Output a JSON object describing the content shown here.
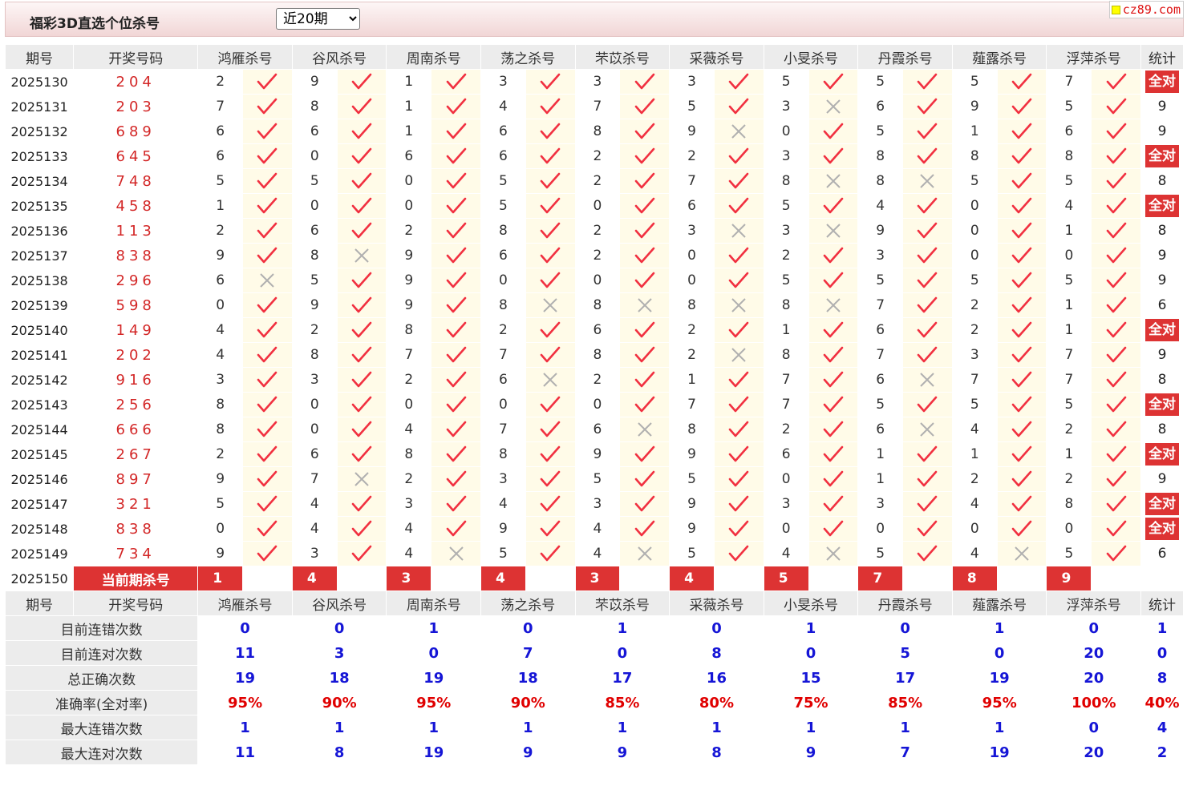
{
  "header": {
    "title": "福彩3D直选个位杀号",
    "period_select": {
      "selected": "近20期"
    }
  },
  "logo": {
    "text": "cz89.com"
  },
  "colors": {
    "check": "#f13040",
    "cross": "#b0b0b0",
    "accent_red": "#dd3333",
    "stat_blue": "#1515d6"
  },
  "table": {
    "headers": [
      "期号",
      "开奖号码",
      "鸿雁杀号",
      "谷风杀号",
      "周南杀号",
      "荡之杀号",
      "芣苡杀号",
      "采薇杀号",
      "小旻杀号",
      "丹霞杀号",
      "薤露杀号",
      "浮萍杀号",
      "统计"
    ],
    "rows": [
      {
        "issue": "2025130",
        "draw": "204",
        "kills": [
          [
            "2",
            true
          ],
          [
            "9",
            true
          ],
          [
            "1",
            true
          ],
          [
            "3",
            true
          ],
          [
            "3",
            true
          ],
          [
            "3",
            true
          ],
          [
            "5",
            true
          ],
          [
            "5",
            true
          ],
          [
            "5",
            true
          ],
          [
            "7",
            true
          ]
        ],
        "stat": "全对"
      },
      {
        "issue": "2025131",
        "draw": "203",
        "kills": [
          [
            "7",
            true
          ],
          [
            "8",
            true
          ],
          [
            "1",
            true
          ],
          [
            "4",
            true
          ],
          [
            "7",
            true
          ],
          [
            "5",
            true
          ],
          [
            "3",
            false
          ],
          [
            "6",
            true
          ],
          [
            "9",
            true
          ],
          [
            "5",
            true
          ]
        ],
        "stat": "9"
      },
      {
        "issue": "2025132",
        "draw": "689",
        "kills": [
          [
            "6",
            true
          ],
          [
            "6",
            true
          ],
          [
            "1",
            true
          ],
          [
            "6",
            true
          ],
          [
            "8",
            true
          ],
          [
            "9",
            false
          ],
          [
            "0",
            true
          ],
          [
            "5",
            true
          ],
          [
            "1",
            true
          ],
          [
            "6",
            true
          ]
        ],
        "stat": "9"
      },
      {
        "issue": "2025133",
        "draw": "645",
        "kills": [
          [
            "6",
            true
          ],
          [
            "0",
            true
          ],
          [
            "6",
            true
          ],
          [
            "6",
            true
          ],
          [
            "2",
            true
          ],
          [
            "2",
            true
          ],
          [
            "3",
            true
          ],
          [
            "8",
            true
          ],
          [
            "8",
            true
          ],
          [
            "8",
            true
          ]
        ],
        "stat": "全对"
      },
      {
        "issue": "2025134",
        "draw": "748",
        "kills": [
          [
            "5",
            true
          ],
          [
            "5",
            true
          ],
          [
            "0",
            true
          ],
          [
            "5",
            true
          ],
          [
            "2",
            true
          ],
          [
            "7",
            true
          ],
          [
            "8",
            false
          ],
          [
            "8",
            false
          ],
          [
            "5",
            true
          ],
          [
            "5",
            true
          ]
        ],
        "stat": "8"
      },
      {
        "issue": "2025135",
        "draw": "458",
        "kills": [
          [
            "1",
            true
          ],
          [
            "0",
            true
          ],
          [
            "0",
            true
          ],
          [
            "5",
            true
          ],
          [
            "0",
            true
          ],
          [
            "6",
            true
          ],
          [
            "5",
            true
          ],
          [
            "4",
            true
          ],
          [
            "0",
            true
          ],
          [
            "4",
            true
          ]
        ],
        "stat": "全对"
      },
      {
        "issue": "2025136",
        "draw": "113",
        "kills": [
          [
            "2",
            true
          ],
          [
            "6",
            true
          ],
          [
            "2",
            true
          ],
          [
            "8",
            true
          ],
          [
            "2",
            true
          ],
          [
            "3",
            false
          ],
          [
            "3",
            false
          ],
          [
            "9",
            true
          ],
          [
            "0",
            true
          ],
          [
            "1",
            true
          ]
        ],
        "stat": "8"
      },
      {
        "issue": "2025137",
        "draw": "838",
        "kills": [
          [
            "9",
            true
          ],
          [
            "8",
            false
          ],
          [
            "9",
            true
          ],
          [
            "6",
            true
          ],
          [
            "2",
            true
          ],
          [
            "0",
            true
          ],
          [
            "2",
            true
          ],
          [
            "3",
            true
          ],
          [
            "0",
            true
          ],
          [
            "0",
            true
          ]
        ],
        "stat": "9"
      },
      {
        "issue": "2025138",
        "draw": "296",
        "kills": [
          [
            "6",
            false
          ],
          [
            "5",
            true
          ],
          [
            "9",
            true
          ],
          [
            "0",
            true
          ],
          [
            "0",
            true
          ],
          [
            "0",
            true
          ],
          [
            "5",
            true
          ],
          [
            "5",
            true
          ],
          [
            "5",
            true
          ],
          [
            "5",
            true
          ]
        ],
        "stat": "9"
      },
      {
        "issue": "2025139",
        "draw": "598",
        "kills": [
          [
            "0",
            true
          ],
          [
            "9",
            true
          ],
          [
            "9",
            true
          ],
          [
            "8",
            false
          ],
          [
            "8",
            false
          ],
          [
            "8",
            false
          ],
          [
            "8",
            false
          ],
          [
            "7",
            true
          ],
          [
            "2",
            true
          ],
          [
            "1",
            true
          ]
        ],
        "stat": "6"
      },
      {
        "issue": "2025140",
        "draw": "149",
        "kills": [
          [
            "4",
            true
          ],
          [
            "2",
            true
          ],
          [
            "8",
            true
          ],
          [
            "2",
            true
          ],
          [
            "6",
            true
          ],
          [
            "2",
            true
          ],
          [
            "1",
            true
          ],
          [
            "6",
            true
          ],
          [
            "2",
            true
          ],
          [
            "1",
            true
          ]
        ],
        "stat": "全对"
      },
      {
        "issue": "2025141",
        "draw": "202",
        "kills": [
          [
            "4",
            true
          ],
          [
            "8",
            true
          ],
          [
            "7",
            true
          ],
          [
            "7",
            true
          ],
          [
            "8",
            true
          ],
          [
            "2",
            false
          ],
          [
            "8",
            true
          ],
          [
            "7",
            true
          ],
          [
            "3",
            true
          ],
          [
            "7",
            true
          ]
        ],
        "stat": "9"
      },
      {
        "issue": "2025142",
        "draw": "916",
        "kills": [
          [
            "3",
            true
          ],
          [
            "3",
            true
          ],
          [
            "2",
            true
          ],
          [
            "6",
            false
          ],
          [
            "2",
            true
          ],
          [
            "1",
            true
          ],
          [
            "7",
            true
          ],
          [
            "6",
            false
          ],
          [
            "7",
            true
          ],
          [
            "7",
            true
          ]
        ],
        "stat": "8"
      },
      {
        "issue": "2025143",
        "draw": "256",
        "kills": [
          [
            "8",
            true
          ],
          [
            "0",
            true
          ],
          [
            "0",
            true
          ],
          [
            "0",
            true
          ],
          [
            "0",
            true
          ],
          [
            "7",
            true
          ],
          [
            "7",
            true
          ],
          [
            "5",
            true
          ],
          [
            "5",
            true
          ],
          [
            "5",
            true
          ]
        ],
        "stat": "全对"
      },
      {
        "issue": "2025144",
        "draw": "666",
        "kills": [
          [
            "8",
            true
          ],
          [
            "0",
            true
          ],
          [
            "4",
            true
          ],
          [
            "7",
            true
          ],
          [
            "6",
            false
          ],
          [
            "8",
            true
          ],
          [
            "2",
            true
          ],
          [
            "6",
            false
          ],
          [
            "4",
            true
          ],
          [
            "2",
            true
          ]
        ],
        "stat": "8"
      },
      {
        "issue": "2025145",
        "draw": "267",
        "kills": [
          [
            "2",
            true
          ],
          [
            "6",
            true
          ],
          [
            "8",
            true
          ],
          [
            "8",
            true
          ],
          [
            "9",
            true
          ],
          [
            "9",
            true
          ],
          [
            "6",
            true
          ],
          [
            "1",
            true
          ],
          [
            "1",
            true
          ],
          [
            "1",
            true
          ]
        ],
        "stat": "全对"
      },
      {
        "issue": "2025146",
        "draw": "897",
        "kills": [
          [
            "9",
            true
          ],
          [
            "7",
            false
          ],
          [
            "2",
            true
          ],
          [
            "3",
            true
          ],
          [
            "5",
            true
          ],
          [
            "5",
            true
          ],
          [
            "0",
            true
          ],
          [
            "1",
            true
          ],
          [
            "2",
            true
          ],
          [
            "2",
            true
          ]
        ],
        "stat": "9"
      },
      {
        "issue": "2025147",
        "draw": "321",
        "kills": [
          [
            "5",
            true
          ],
          [
            "4",
            true
          ],
          [
            "3",
            true
          ],
          [
            "4",
            true
          ],
          [
            "3",
            true
          ],
          [
            "9",
            true
          ],
          [
            "3",
            true
          ],
          [
            "3",
            true
          ],
          [
            "4",
            true
          ],
          [
            "8",
            true
          ]
        ],
        "stat": "全对"
      },
      {
        "issue": "2025148",
        "draw": "838",
        "kills": [
          [
            "0",
            true
          ],
          [
            "4",
            true
          ],
          [
            "4",
            true
          ],
          [
            "9",
            true
          ],
          [
            "4",
            true
          ],
          [
            "9",
            true
          ],
          [
            "0",
            true
          ],
          [
            "0",
            true
          ],
          [
            "0",
            true
          ],
          [
            "0",
            true
          ]
        ],
        "stat": "全对"
      },
      {
        "issue": "2025149",
        "draw": "734",
        "kills": [
          [
            "9",
            true
          ],
          [
            "3",
            true
          ],
          [
            "4",
            false
          ],
          [
            "5",
            true
          ],
          [
            "4",
            false
          ],
          [
            "5",
            true
          ],
          [
            "4",
            false
          ],
          [
            "5",
            true
          ],
          [
            "4",
            false
          ],
          [
            "5",
            true
          ]
        ],
        "stat": "6"
      }
    ],
    "current": {
      "issue": "2025150",
      "label": "当前期杀号",
      "kills": [
        "1",
        "4",
        "3",
        "4",
        "3",
        "4",
        "5",
        "7",
        "8",
        "9"
      ]
    },
    "stats": [
      {
        "label": "目前连错次数",
        "values": [
          "0",
          "0",
          "1",
          "0",
          "1",
          "0",
          "1",
          "0",
          "1",
          "0",
          "1"
        ]
      },
      {
        "label": "目前连对次数",
        "values": [
          "11",
          "3",
          "0",
          "7",
          "0",
          "8",
          "0",
          "5",
          "0",
          "20",
          "0"
        ]
      },
      {
        "label": "总正确次数",
        "values": [
          "19",
          "18",
          "19",
          "18",
          "17",
          "16",
          "15",
          "17",
          "19",
          "20",
          "8"
        ]
      },
      {
        "label": "准确率(全对率)",
        "values": [
          "95%",
          "90%",
          "95%",
          "90%",
          "85%",
          "80%",
          "75%",
          "85%",
          "95%",
          "100%",
          "40%"
        ],
        "pct": true
      },
      {
        "label": "最大连错次数",
        "values": [
          "1",
          "1",
          "1",
          "1",
          "1",
          "1",
          "1",
          "1",
          "1",
          "0",
          "4"
        ]
      },
      {
        "label": "最大连对次数",
        "values": [
          "11",
          "8",
          "19",
          "9",
          "9",
          "8",
          "9",
          "7",
          "19",
          "20",
          "2"
        ]
      }
    ]
  }
}
